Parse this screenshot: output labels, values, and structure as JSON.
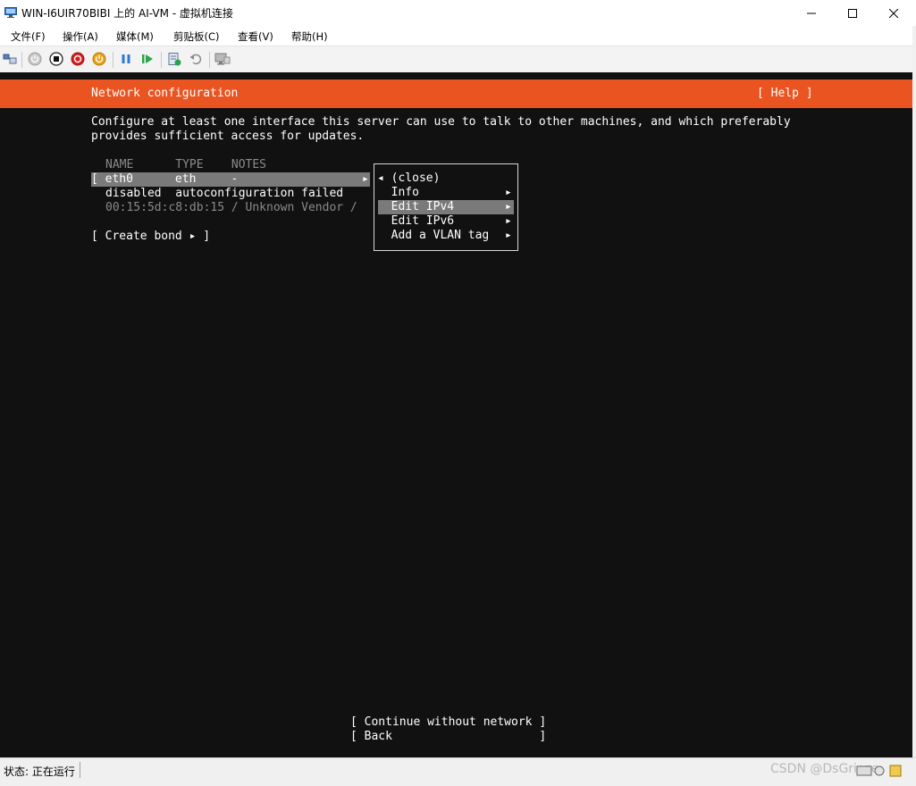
{
  "window": {
    "title": "WIN-I6UIR70BIBI 上的 AI-VM - 虚拟机连接",
    "controls": {
      "minimize": "minimize-icon",
      "maximize": "maximize-icon",
      "close": "close-icon"
    }
  },
  "menu": {
    "items": [
      "文件(F)",
      "操作(A)",
      "媒体(M)",
      "剪贴板(C)",
      "查看(V)",
      "帮助(H)"
    ]
  },
  "toolbar": {
    "icons": [
      "ctrl-alt-del-icon",
      "start-icon",
      "turn-off-icon",
      "shutdown-icon",
      "power-icon",
      "pause-icon",
      "resume-icon",
      "checkpoint-icon",
      "revert-icon",
      "enhanced-session-icon"
    ]
  },
  "terminal": {
    "header_title": "Network configuration",
    "header_help": "[ Help ]",
    "intro_line1": "Configure at least one interface this server can use to talk to other machines, and which preferably",
    "intro_line2": "provides sufficient access for updates.",
    "table_headers": "NAME      TYPE    NOTES",
    "eth_row_left": "[ eth0      eth     -",
    "eth_row_arrow": "▸",
    "status_row": "disabled  autoconfiguration failed",
    "mac_row": "00:15:5d:c8:db:15 / Unknown Vendor /",
    "create_bond": "[ Create bond ▸ ]",
    "popup": {
      "items": [
        {
          "label": "◂ (close)",
          "arrow": ""
        },
        {
          "label": "  Info",
          "arrow": "▸"
        },
        {
          "label": "  Edit IPv4",
          "arrow": "▸"
        },
        {
          "label": "  Edit IPv6",
          "arrow": "▸"
        },
        {
          "label": "  Add a VLAN tag",
          "arrow": "▸"
        }
      ],
      "selected_index": 2
    },
    "continue_button": "[ Continue without network ]",
    "back_button": "[ Back                     ]",
    "colors": {
      "header_bg": "#e95420",
      "background": "#111111",
      "highlight": "#7a7a7a"
    }
  },
  "statusbar": {
    "status": "状态: 正在运行",
    "watermark": "CSDN @DsGrieze"
  }
}
